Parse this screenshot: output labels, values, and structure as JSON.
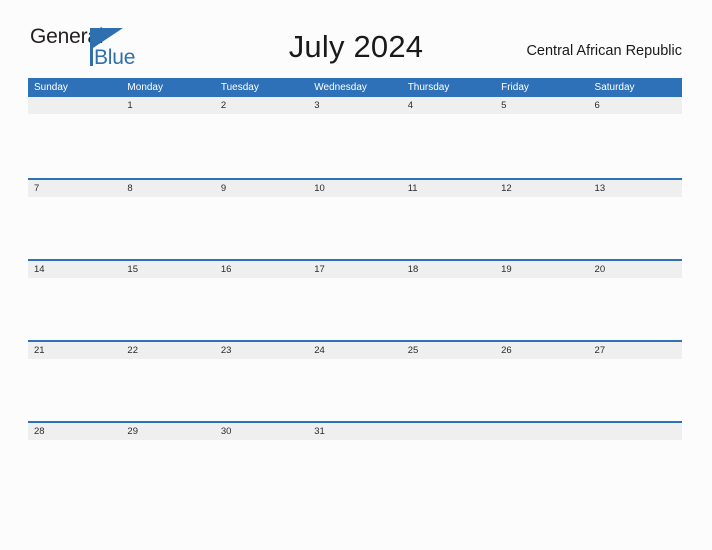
{
  "logo": {
    "text_primary": "General",
    "text_secondary": "Blue",
    "primary_color": "#231F20",
    "secondary_color": "#2E6FAF",
    "flag_icon": "blue-triangle-flag-icon"
  },
  "header": {
    "month_title": "July 2024",
    "locale": "Central African Republic"
  },
  "theme": {
    "header_blue": "#2E71B8",
    "row_band_gray": "#EFEFEF",
    "page_background": "#FCFCFC",
    "text_color": "#2B2B2B"
  },
  "calendar": {
    "weekdays": [
      "Sunday",
      "Monday",
      "Tuesday",
      "Wednesday",
      "Thursday",
      "Friday",
      "Saturday"
    ],
    "weeks": [
      [
        "",
        "1",
        "2",
        "3",
        "4",
        "5",
        "6"
      ],
      [
        "7",
        "8",
        "9",
        "10",
        "11",
        "12",
        "13"
      ],
      [
        "14",
        "15",
        "16",
        "17",
        "18",
        "19",
        "20"
      ],
      [
        "21",
        "22",
        "23",
        "24",
        "25",
        "26",
        "27"
      ],
      [
        "28",
        "29",
        "30",
        "31",
        "",
        "",
        ""
      ]
    ]
  }
}
